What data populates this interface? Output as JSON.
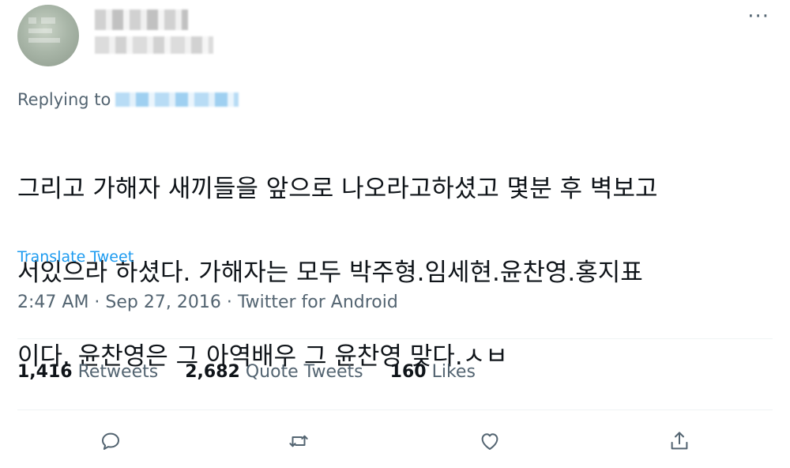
{
  "tweet": {
    "more_label": "···",
    "replying_label": "Replying to",
    "text_lines": [
      "그리고 가해자 새끼들을 앞으로 나오라고하셨고 몇분 후 벽보고",
      "서있으라 하셨다. 가해자는 모두 박주형.임세현.윤찬영.홍지표",
      "이다. 윤찬영은 그 아역배우 그 윤찬영 맞다.ㅅㅂ"
    ],
    "translate_label": "Translate Tweet",
    "meta": "2:47 AM · Sep 27, 2016 · Twitter for Android"
  },
  "stats": {
    "retweets_count": "1,416",
    "retweets_label": "Retweets",
    "quote_count": "2,682",
    "quote_label": "Quote Tweets",
    "likes_count": "160",
    "likes_label": "Likes"
  },
  "colors": {
    "accent": "#1d9bf0",
    "text_primary": "#0f1419",
    "text_secondary": "#536471"
  },
  "icons": {
    "reply": "reply-icon",
    "retweet": "retweet-icon",
    "like": "heart-icon",
    "share": "share-icon"
  }
}
